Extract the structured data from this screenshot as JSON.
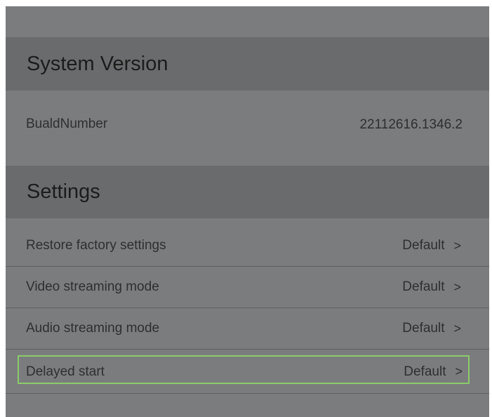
{
  "system_version": {
    "title": "System Version",
    "rows": [
      {
        "label": "BualdNumber",
        "value": "22112616.1346.2"
      }
    ]
  },
  "settings": {
    "title": "Settings",
    "items": [
      {
        "label": "Restore factory settings",
        "value": "Default",
        "chevron": ">"
      },
      {
        "label": "Video streaming mode",
        "value": "Default",
        "chevron": ">"
      },
      {
        "label": "Audio streaming mode",
        "value": "Default",
        "chevron": ">"
      },
      {
        "label": "Delayed start",
        "value": "Default",
        "chevron": ">",
        "focused": true
      }
    ]
  },
  "colors": {
    "panel_background": "#7b7c7e",
    "section_header_background": "#6a6b6c",
    "focus_outline": "#8bcc6a"
  }
}
